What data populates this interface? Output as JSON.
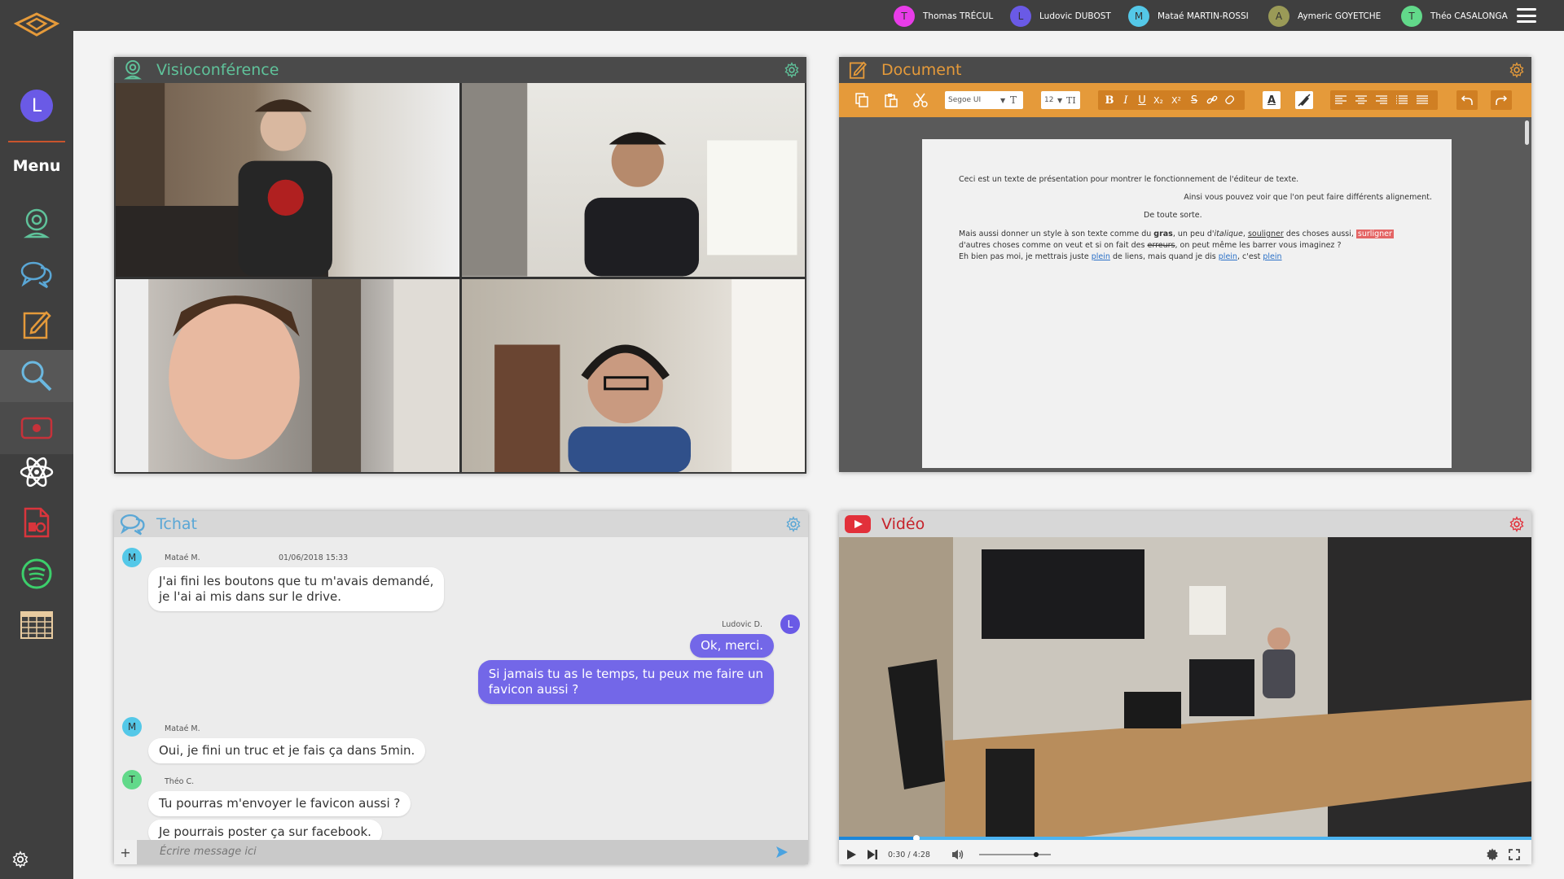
{
  "users": [
    {
      "initial": "T",
      "name": "Thomas TRÉCUL",
      "color": "#e83ce8"
    },
    {
      "initial": "L",
      "name": "Ludovic DUBOST",
      "color": "#6a5ae6"
    },
    {
      "initial": "M",
      "name": "Mataé MARTIN-ROSSI",
      "color": "#54c8e8"
    },
    {
      "initial": "A",
      "name": "Aymeric GOYETCHE",
      "color": "#9a9a57"
    },
    {
      "initial": "T",
      "name": "Théo CASALONGA",
      "color": "#62d98a"
    }
  ],
  "sidebar": {
    "avatar_initial": "L",
    "menu_label": "Menu",
    "items": [
      {
        "icon": "webcam-icon"
      },
      {
        "icon": "chat-icon"
      },
      {
        "icon": "document-icon"
      },
      {
        "icon": "search-icon"
      },
      {
        "icon": "video-icon"
      },
      {
        "icon": "atom-icon"
      },
      {
        "icon": "pdf-icon"
      },
      {
        "icon": "spotify-icon"
      },
      {
        "icon": "spreadsheet-icon"
      }
    ],
    "settings_icon": "gear-icon"
  },
  "visio": {
    "title": "Visioconférence",
    "accent": "#5fc29a"
  },
  "document": {
    "title": "Document",
    "accent": "#e59a3a",
    "font_select": "Segoe UI",
    "size_select": "12",
    "lines": {
      "l1": "Ceci est un texte de présentation pour montrer le fonctionnement de l'éditeur de texte.",
      "l2": "Ainsi vous pouvez voir que l'on peut faire différents alignement.",
      "l3": "De toute sorte.",
      "l4a": "Mais aussi donner un style à son texte comme du ",
      "l4b": "gras",
      "l4c": ", un peu d'",
      "l4d": "italique",
      "l4e": ", ",
      "l4f": "souligner",
      "l4g": " des choses aussi, ",
      "l4h": "surligner",
      "l5a": "d'autres choses comme on veut et si on fait des ",
      "l5b": "erreurs",
      "l5c": ", on peut même les barrer vous imaginez ?",
      "l6a": "Eh bien pas moi, je mettrais juste ",
      "l6b": "plein",
      "l6c": " de liens, mais quand je dis ",
      "l6d": "plein",
      "l6e": ", c'est ",
      "l6f": "plein"
    }
  },
  "chat": {
    "title": "Tchat",
    "accent": "#5aa7d6",
    "input_placeholder": "Écrire message ici",
    "messages": [
      {
        "initial": "M",
        "author": "Mataé M.",
        "date": "01/06/2018 15:33",
        "text1": "J'ai fini les boutons que tu m'avais demandé,",
        "text2": "je l'ai ai mis dans sur le drive."
      },
      {
        "initial": "L",
        "author": "Ludovic D.",
        "text": "Ok, merci."
      },
      {
        "text1": "Si jamais tu as le temps, tu peux me faire un",
        "text2": "favicon aussi ?"
      },
      {
        "initial": "M",
        "author": "Mataé M.",
        "text": "Oui, je fini un truc et je fais ça dans 5min."
      },
      {
        "initial": "T",
        "author": "Théo C.",
        "text": "Tu pourras m'envoyer le favicon aussi ?"
      },
      {
        "text": "Je pourrais poster ça sur facebook."
      }
    ]
  },
  "video": {
    "title": "Vidéo",
    "accent": "#e2303a",
    "time": "0:30 / 4:28",
    "progress": 0.112,
    "volume": 0.8
  }
}
